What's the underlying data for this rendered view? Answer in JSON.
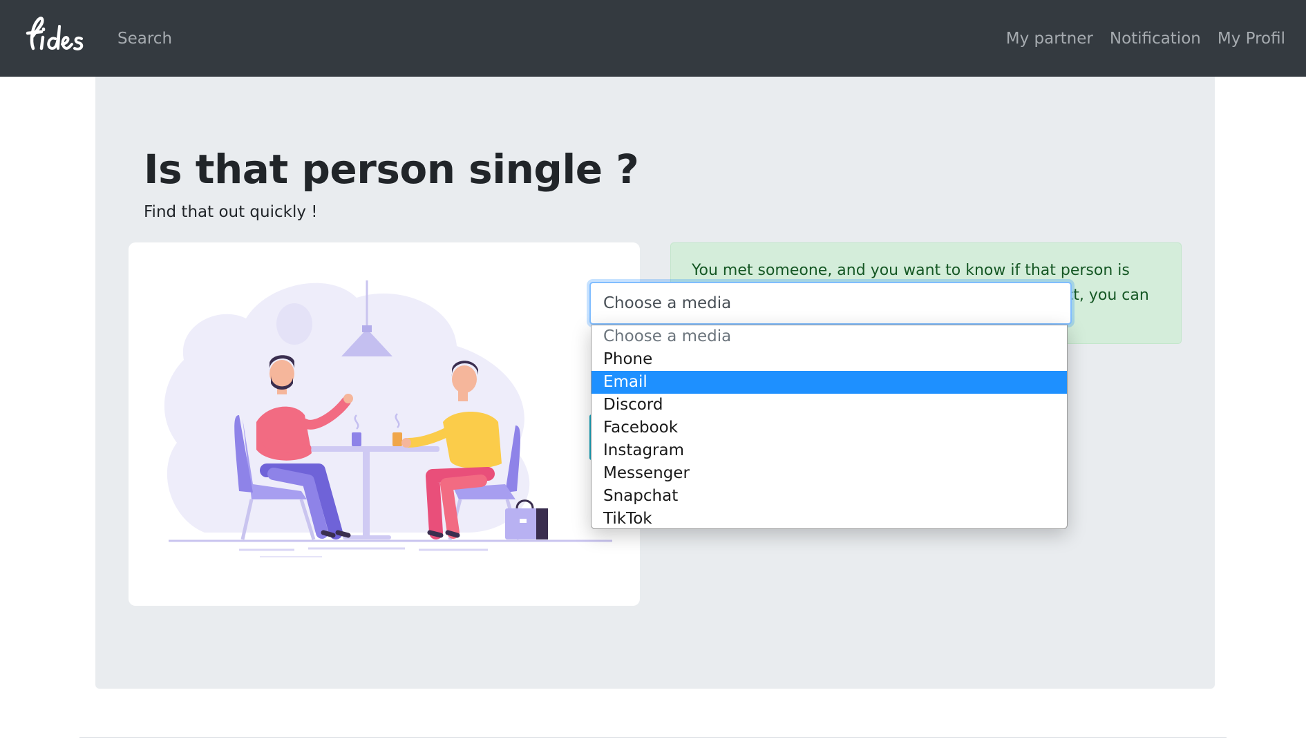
{
  "navbar": {
    "brand": "fides",
    "search_label": "Search",
    "links": [
      "My partner",
      "Notification",
      "My Profil"
    ]
  },
  "hero": {
    "title": "Is that person single ?",
    "subtitle": "Find that out quickly !"
  },
  "alert": {
    "text": "You met someone, and you want to know if that person is taken already ? If that person gave you his contact, you can try to find him here.",
    "color": "#d4edda"
  },
  "media_select": {
    "current_value": "Choose a media",
    "highlighted_option": "Email",
    "options": [
      "Choose a media",
      "Phone",
      "Email",
      "Discord",
      "Facebook",
      "Instagram",
      "Messenger",
      "Snapchat",
      "TikTok"
    ]
  },
  "colors": {
    "navbar": "#343a40",
    "jumbotron": "#e9ecef",
    "highlight": "#1e90ff",
    "focus_ring": "#80bdff"
  }
}
